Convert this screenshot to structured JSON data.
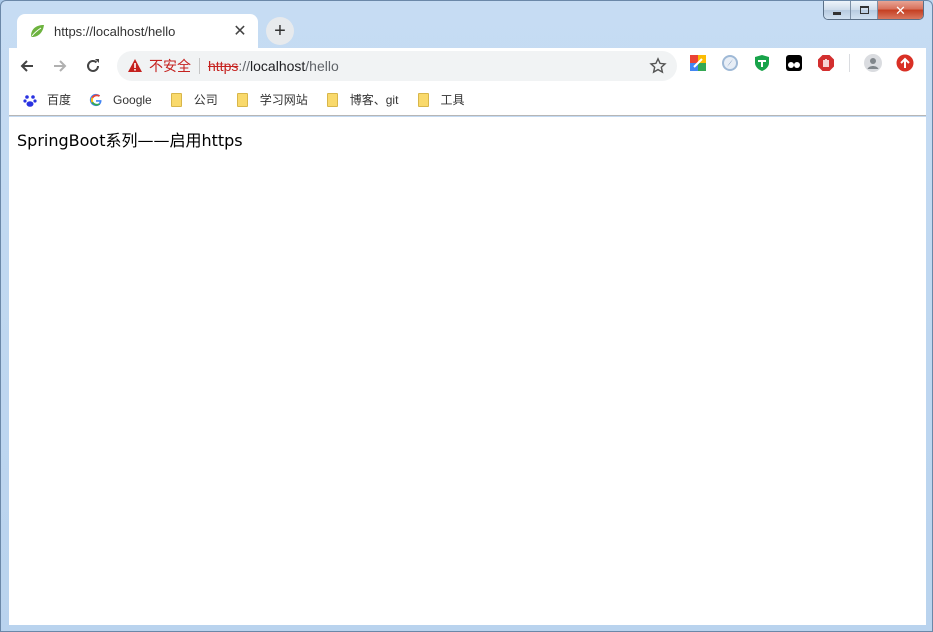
{
  "window": {
    "caption": {
      "close_glyph": "✕"
    }
  },
  "tab": {
    "title": "https://localhost/hello",
    "favicon": "spring-leaf-icon",
    "close_glyph": "✕"
  },
  "new_tab_glyph": "+",
  "omnibox": {
    "security_label": "不安全",
    "url_scheme": "https",
    "url_sep": "://",
    "url_host": "localhost",
    "url_path": "/hello"
  },
  "bookmarks": [
    {
      "label": "百度",
      "icon": "baidu-paw-icon"
    },
    {
      "label": "Google",
      "icon": "google-g-icon"
    },
    {
      "label": "公司",
      "icon": "folder-icon"
    },
    {
      "label": "学习网站",
      "icon": "folder-icon"
    },
    {
      "label": "博客、git",
      "icon": "folder-icon"
    },
    {
      "label": "工具",
      "icon": "folder-icon"
    }
  ],
  "page": {
    "text": "SpringBoot系列——启用https"
  },
  "colors": {
    "insecure_red": "#c5221f",
    "frame_blue": "#b9d3ee"
  }
}
